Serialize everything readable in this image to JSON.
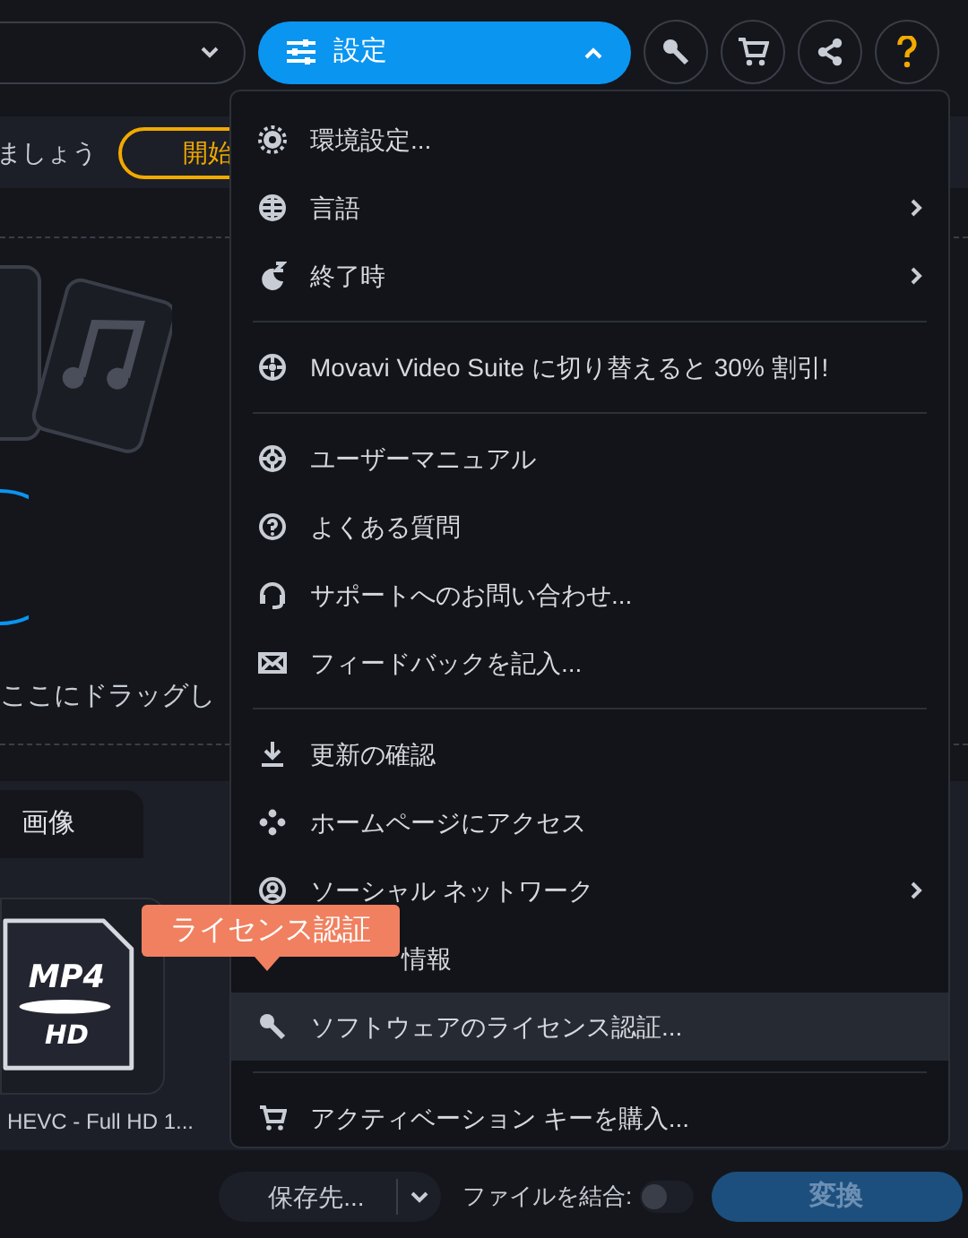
{
  "toolbar": {
    "settings_button": {
      "label": "設定",
      "expanded": true
    }
  },
  "banner": {
    "text": "ましょう",
    "button": "開始"
  },
  "drop_area": {
    "hint": "ここにドラッグし"
  },
  "format_tabs": [
    {
      "label": "画像",
      "selected": true
    }
  ],
  "presets": [
    {
      "label": "HEVC - Full HD 1...",
      "icon_format": "MP4",
      "icon_quality": "HD"
    }
  ],
  "settings_menu": [
    {
      "kind": "item",
      "label": "環境設定...",
      "submenu": false,
      "selected": false
    },
    {
      "kind": "item",
      "label": "言語",
      "submenu": true,
      "selected": false
    },
    {
      "kind": "item",
      "label": "終了時",
      "submenu": true,
      "selected": false
    },
    {
      "kind": "separator"
    },
    {
      "kind": "item",
      "label": "Movavi Video Suite に切り替えると 30% 割引!",
      "submenu": false,
      "selected": false
    },
    {
      "kind": "separator"
    },
    {
      "kind": "item",
      "label": "ユーザーマニュアル",
      "submenu": false,
      "selected": false
    },
    {
      "kind": "item",
      "label": "よくある質問",
      "submenu": false,
      "selected": false
    },
    {
      "kind": "item",
      "label": "サポートへのお問い合わせ...",
      "submenu": false,
      "selected": false
    },
    {
      "kind": "item",
      "label": "フィードバックを記入...",
      "submenu": false,
      "selected": false
    },
    {
      "kind": "separator"
    },
    {
      "kind": "item",
      "label": "更新の確認",
      "submenu": false,
      "selected": false
    },
    {
      "kind": "item",
      "label": "ホームページにアクセス",
      "submenu": false,
      "selected": false
    },
    {
      "kind": "item",
      "label": "ソーシャル ネットワーク",
      "submenu": true,
      "selected": false
    },
    {
      "kind": "covered",
      "label": "情報",
      "submenu": false,
      "selected": false
    },
    {
      "kind": "item",
      "label": "ソフトウェアのライセンス認証...",
      "submenu": false,
      "selected": true
    },
    {
      "kind": "separator"
    },
    {
      "kind": "item",
      "label": "アクティベーション キーを購入...",
      "submenu": false,
      "selected": false
    }
  ],
  "tooltip": {
    "text": "ライセンス認証"
  },
  "bottom_bar": {
    "save_button": "保存先...",
    "merge_label": "ファイルを結合:",
    "merge_on": false,
    "convert_button": "変換"
  }
}
